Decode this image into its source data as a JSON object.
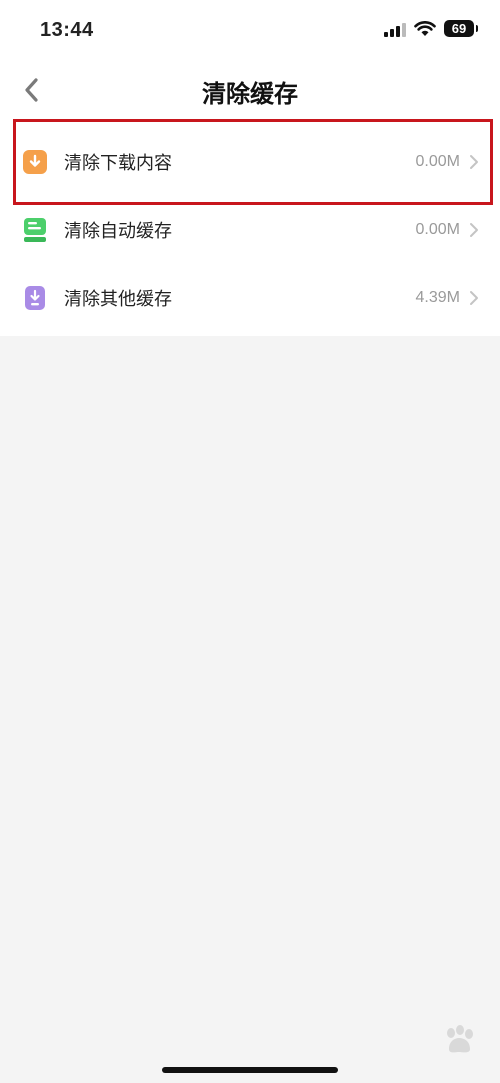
{
  "status": {
    "time": "13:44",
    "battery": "69"
  },
  "nav": {
    "back_icon": "chevron-left-icon",
    "title": "清除缓存"
  },
  "items": [
    {
      "label": "清除下载内容",
      "value": "0.00M",
      "icon": "download-icon",
      "color": "#f5a04a"
    },
    {
      "label": "清除自动缓存",
      "value": "0.00M",
      "icon": "auto-cache-icon",
      "color": "#4ccf6b"
    },
    {
      "label": "清除其他缓存",
      "value": "4.39M",
      "icon": "other-cache-icon",
      "color": "#a98be6"
    }
  ],
  "colors": {
    "highlight": "#c8161d",
    "background": "#f4f4f4",
    "value_text": "#9a9a9a"
  }
}
